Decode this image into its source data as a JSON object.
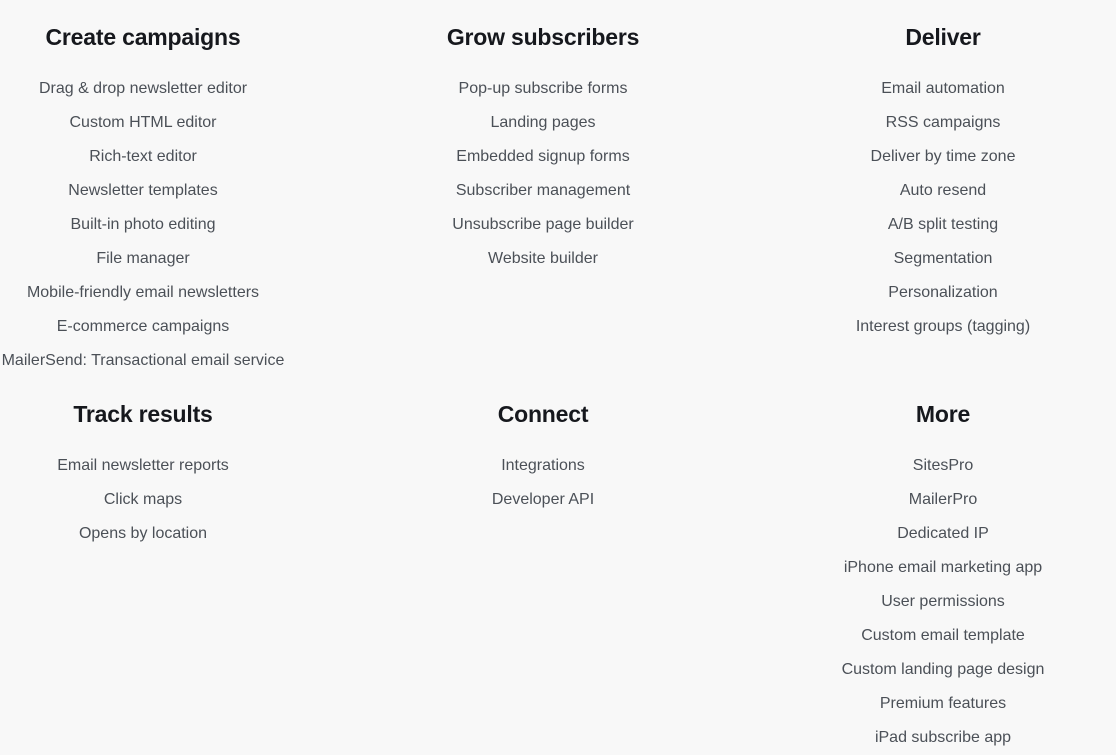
{
  "page": {
    "background_color": "#f8f8f8",
    "heading_color": "#16181d",
    "link_color": "#4b5057"
  },
  "sections": [
    {
      "id": "create-campaigns",
      "heading": "Create campaigns",
      "links": [
        "Drag & drop newsletter editor",
        "Custom HTML editor",
        "Rich-text editor",
        "Newsletter templates",
        "Built-in photo editing",
        "File manager",
        "Mobile-friendly email newsletters",
        "E-commerce campaigns",
        "MailerSend: Transactional email service"
      ]
    },
    {
      "id": "grow-subscribers",
      "heading": "Grow subscribers",
      "links": [
        "Pop-up subscribe forms",
        "Landing pages",
        "Embedded signup forms",
        "Subscriber management",
        "Unsubscribe page builder",
        "Website builder"
      ]
    },
    {
      "id": "deliver",
      "heading": "Deliver",
      "links": [
        "Email automation",
        "RSS campaigns",
        "Deliver by time zone",
        "Auto resend",
        "A/B split testing",
        "Segmentation",
        "Personalization",
        "Interest groups (tagging)"
      ]
    },
    {
      "id": "track-results",
      "heading": "Track results",
      "links": [
        "Email newsletter reports",
        "Click maps",
        "Opens by location"
      ]
    },
    {
      "id": "connect",
      "heading": "Connect",
      "links": [
        "Integrations",
        "Developer API"
      ]
    },
    {
      "id": "more",
      "heading": "More",
      "links": [
        "SitesPro",
        "MailerPro",
        "Dedicated IP",
        "iPhone email marketing app",
        "User permissions",
        "Custom email template",
        "Custom landing page design",
        "Premium features",
        "iPad subscribe app"
      ]
    }
  ]
}
